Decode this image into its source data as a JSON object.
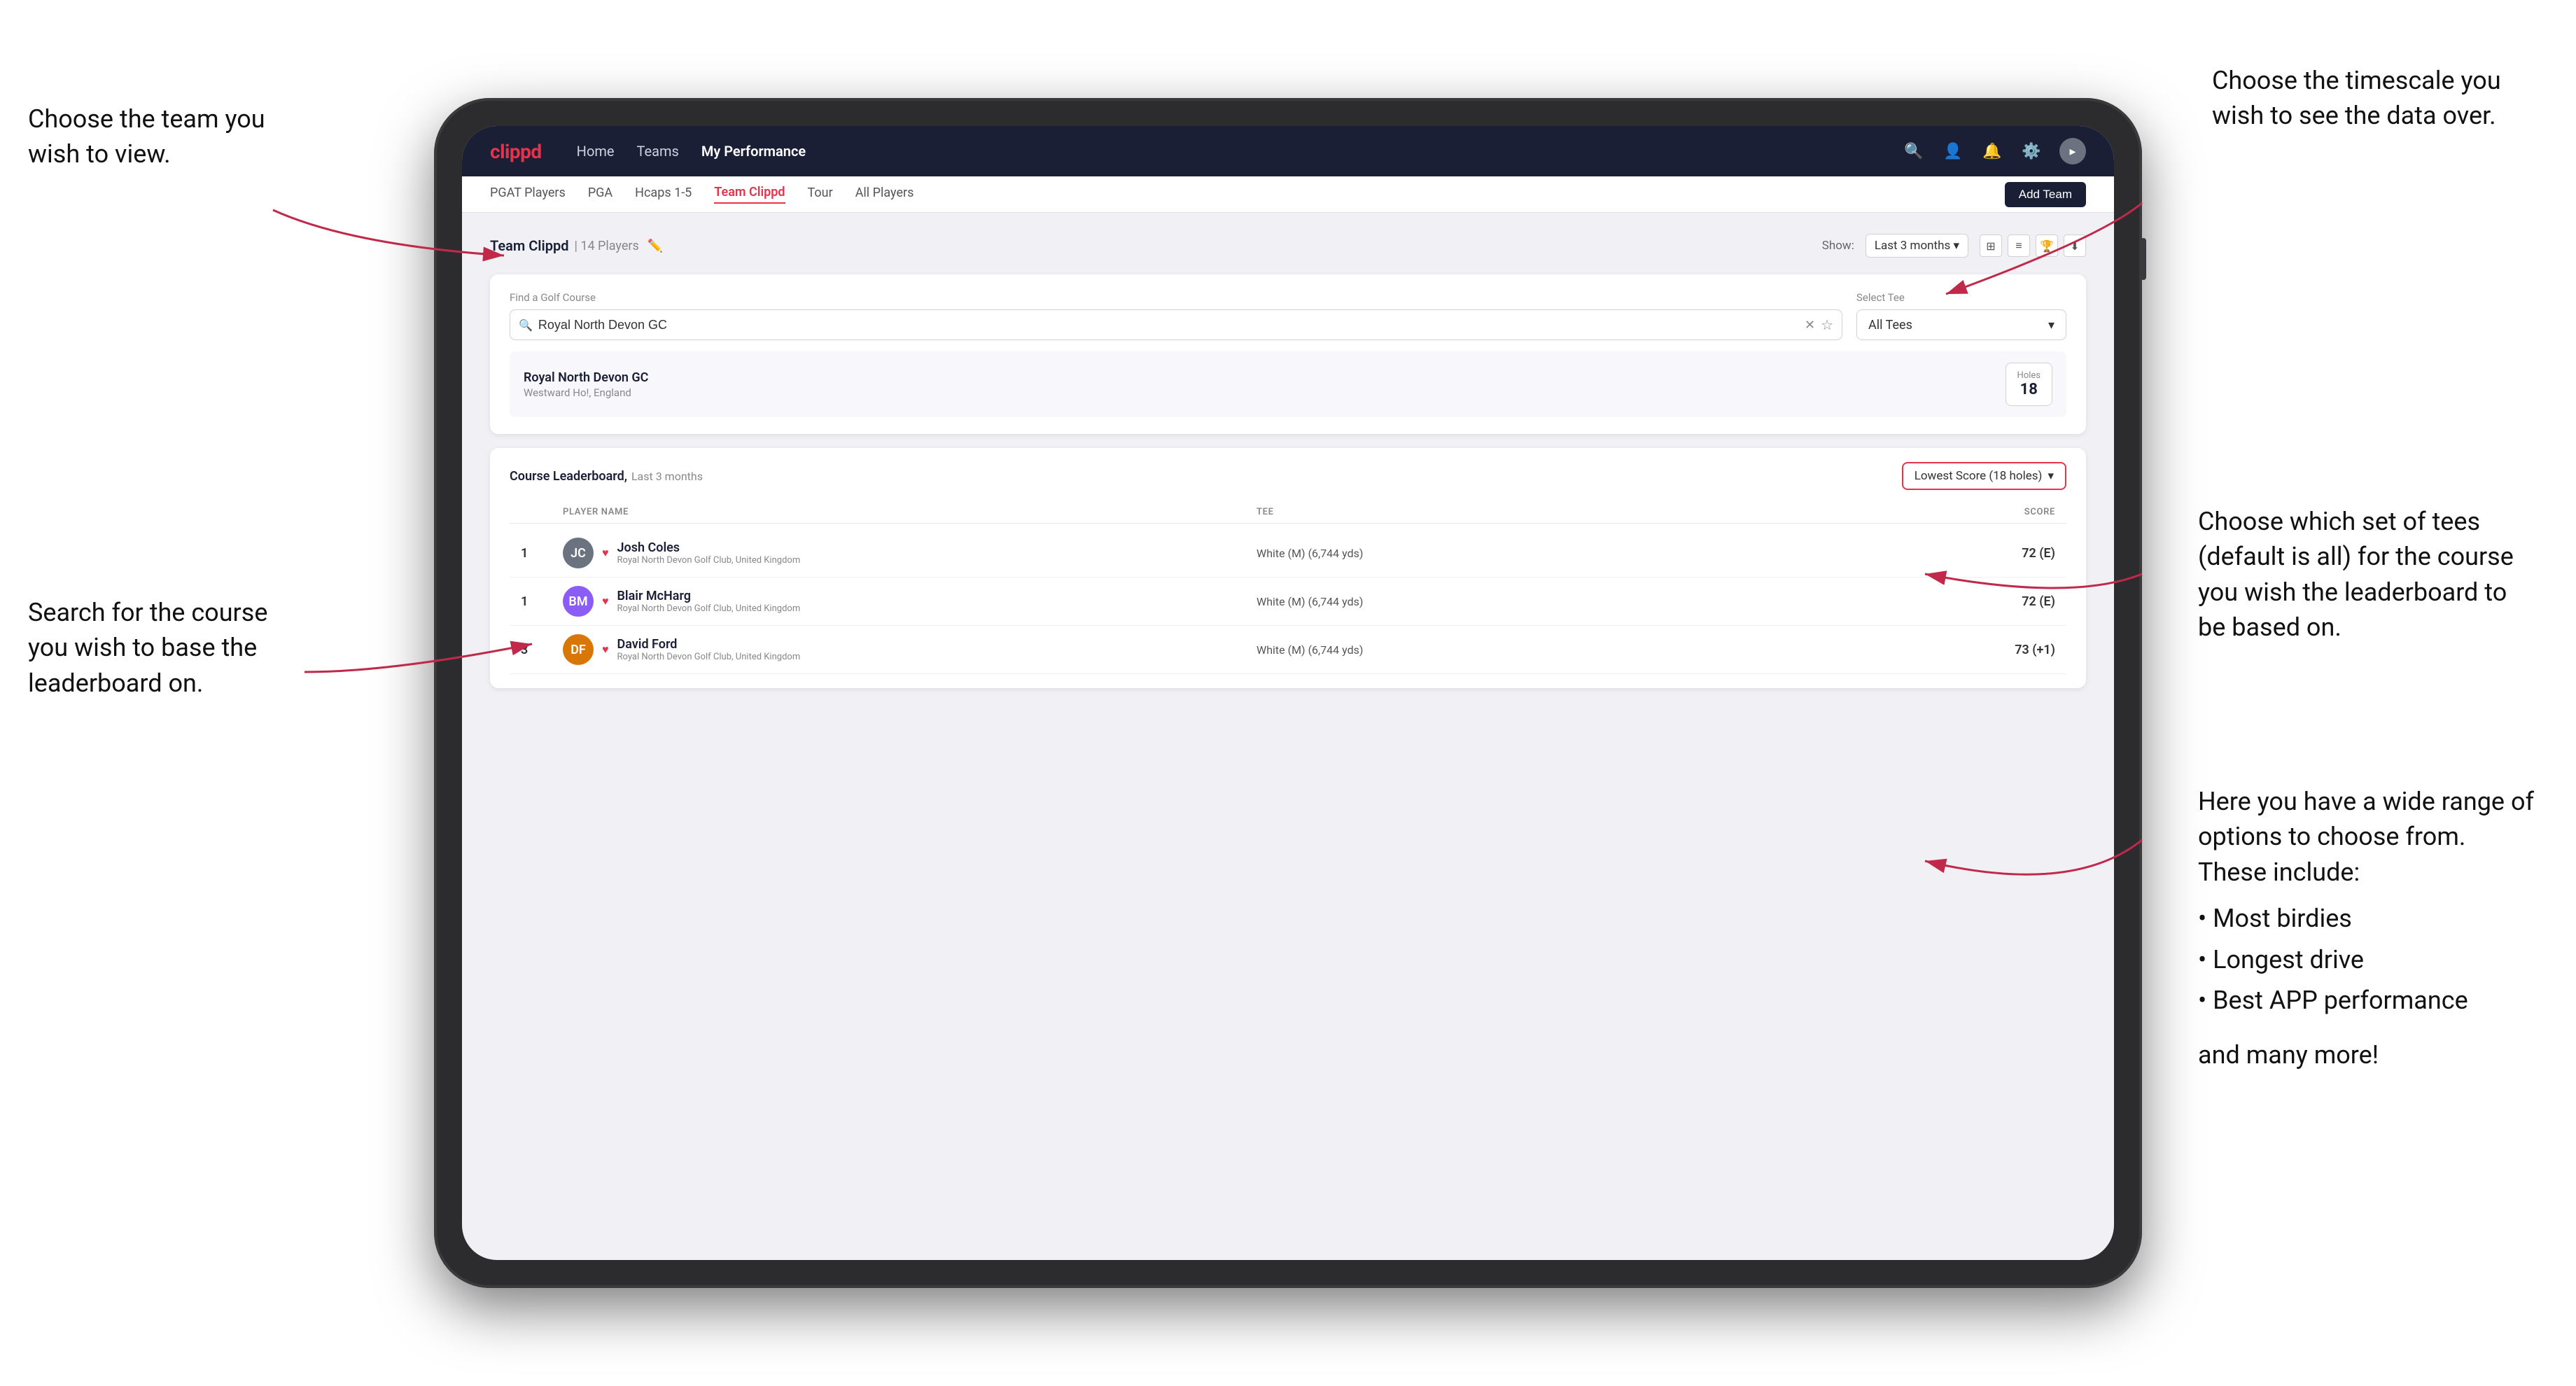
{
  "annotations": {
    "top_left": {
      "title": "Choose the team you\nwish to view."
    },
    "top_right": {
      "title": "Choose the timescale you\nwish to see the data over."
    },
    "mid_right": {
      "title": "Choose which set of tees\n(default is all) for the course\nyou wish the leaderboard to\nbe based on."
    },
    "mid_left": {
      "title": "Search for the course\nyou wish to base the\nleaderboard on."
    },
    "bottom_right": {
      "title": "Here you have a wide range\nof options to choose from.\nThese include:",
      "bullets": [
        "Most birdies",
        "Longest drive",
        "Best APP performance"
      ],
      "footer": "and many more!"
    }
  },
  "nav": {
    "logo": "clippd",
    "links": [
      {
        "label": "Home",
        "active": false
      },
      {
        "label": "Teams",
        "active": false
      },
      {
        "label": "My Performance",
        "active": true
      }
    ],
    "icons": [
      "search",
      "users",
      "bell",
      "settings",
      "user"
    ]
  },
  "tabs": {
    "items": [
      {
        "label": "PGAT Players",
        "active": false
      },
      {
        "label": "PGA",
        "active": false
      },
      {
        "label": "Hcaps 1-5",
        "active": false
      },
      {
        "label": "Team Clippd",
        "active": true
      },
      {
        "label": "Tour",
        "active": false
      },
      {
        "label": "All Players",
        "active": false
      }
    ],
    "add_button": "Add Team"
  },
  "content": {
    "team_name": "Team Clippd",
    "player_count": "14 Players",
    "show_label": "Show:",
    "show_value": "Last 3 months",
    "search": {
      "label": "Find a Golf Course",
      "value": "Royal North Devon GC",
      "placeholder": "Find a Golf Course"
    },
    "select_tee": {
      "label": "Select Tee",
      "value": "All Tees"
    },
    "course_result": {
      "name": "Royal North Devon GC",
      "location": "Westward Ho!, England",
      "holes_label": "Holes",
      "holes": "18"
    },
    "leaderboard": {
      "title": "Course Leaderboard,",
      "subtitle": "Last 3 months",
      "score_select": "Lowest Score (18 holes)",
      "col_headers": [
        "",
        "PLAYER NAME",
        "TEE",
        "SCORE"
      ],
      "players": [
        {
          "rank": "1",
          "name": "Josh Coles",
          "club": "Royal North Devon Golf Club, United Kingdom",
          "tee": "White (M) (6,744 yds)",
          "score": "72 (E)",
          "avatar_color": "#6b7280",
          "avatar_initials": "JC"
        },
        {
          "rank": "1",
          "name": "Blair McHarg",
          "club": "Royal North Devon Golf Club, United Kingdom",
          "tee": "White (M) (6,744 yds)",
          "score": "72 (E)",
          "avatar_color": "#8b5cf6",
          "avatar_initials": "BM"
        },
        {
          "rank": "3",
          "name": "David Ford",
          "club": "Royal North Devon Golf Club, United Kingdom",
          "tee": "White (M) (6,744 yds)",
          "score": "73 (+1)",
          "avatar_color": "#d97706",
          "avatar_initials": "DF"
        }
      ]
    }
  }
}
